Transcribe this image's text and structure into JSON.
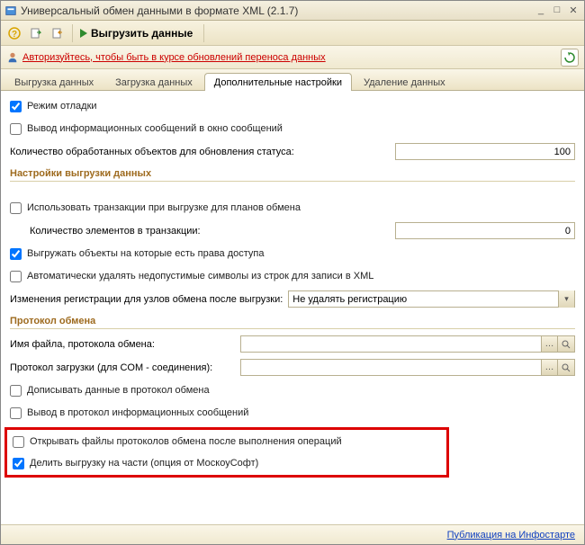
{
  "window": {
    "title": "Универсальный обмен данными в формате XML (2.1.7)"
  },
  "toolbar": {
    "export_label": "Выгрузить данные"
  },
  "auth": {
    "link": "Авторизуйтесь, чтобы быть в курсе обновлений переноса данных"
  },
  "tabs": [
    {
      "label": "Выгрузка данных"
    },
    {
      "label": "Загрузка данных"
    },
    {
      "label": "Дополнительные настройки"
    },
    {
      "label": "Удаление данных"
    }
  ],
  "active_tab": 2,
  "settings": {
    "debug_mode": "Режим отладки",
    "info_to_window": "Вывод информационных сообщений в окно сообщений",
    "processed_count_label": "Количество обработанных объектов для обновления статуса:",
    "processed_count_value": "100",
    "section_export": "Настройки выгрузки данных",
    "use_transactions": "Использовать транзакции при выгрузке для планов обмена",
    "trans_count_label": "Количество элементов в транзакции:",
    "trans_count_value": "0",
    "export_with_rights": "Выгружать объекты на которые есть права доступа",
    "auto_remove_invalid": "Автоматически удалять недопустимые символы из строк для записи в XML",
    "reg_changes_label": "Изменения регистрации для узлов обмена после выгрузки:",
    "reg_changes_value": "Не удалять регистрацию",
    "section_protocol": "Протокол обмена",
    "proto_file_label": "Имя файла, протокола обмена:",
    "proto_file_value": "",
    "proto_load_label": "Протокол загрузки (для COM - соединения):",
    "proto_load_value": "",
    "append_proto": "Дописывать данные в протокол обмена",
    "info_to_proto": "Вывод в протокол информационных сообщений",
    "open_proto_after": "Открывать файлы протоколов обмена после выполнения операций",
    "split_parts": "Делить выгрузку на части (опция от МоскоуСофт)"
  },
  "footer": {
    "link": "Публикация на Инфостарте"
  }
}
